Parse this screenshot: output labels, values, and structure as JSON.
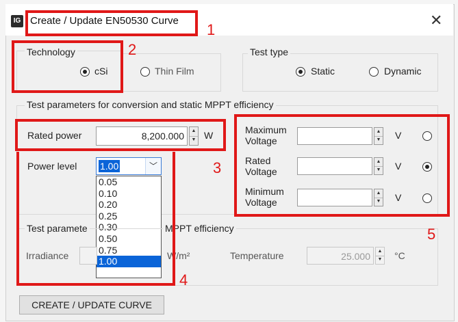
{
  "window": {
    "title": "Create / Update EN50530 Curve",
    "close_label": "✕",
    "icon_text": "IG"
  },
  "technology": {
    "legend": "Technology",
    "options": [
      {
        "label": "cSi",
        "selected": true
      },
      {
        "label": "Thin Film",
        "selected": false
      }
    ]
  },
  "test_type": {
    "legend": "Test type",
    "options": [
      {
        "label": "Static",
        "selected": true
      },
      {
        "label": "Dynamic",
        "selected": false
      }
    ]
  },
  "static_params": {
    "legend": "Test parameters for conversion and static MPPT efficiency",
    "rated_power": {
      "label": "Rated power",
      "value": "8,200.000",
      "unit": "W"
    },
    "power_level": {
      "label": "Power level",
      "value": "1.00",
      "options": [
        "0.05",
        "0.10",
        "0.20",
        "0.25",
        "0.30",
        "0.50",
        "0.75",
        "1.00"
      ]
    },
    "voltages": [
      {
        "label_line1": "Maximum",
        "label_line2": "Voltage",
        "value": "",
        "unit": "V",
        "selected": false
      },
      {
        "label_line1": "Rated",
        "label_line2": "Voltage",
        "value": "",
        "unit": "V",
        "selected": true
      },
      {
        "label_line1": "Minimum",
        "label_line2": "Voltage",
        "value": "",
        "unit": "V",
        "selected": false
      }
    ]
  },
  "dynamic_params": {
    "legend_left": "Test paramete",
    "legend_right": "MPPT efficiency",
    "irradiance": {
      "label": "Irradiance",
      "value": "",
      "unit": "W/m²"
    },
    "temperature": {
      "label": "Temperature",
      "value": "25.000",
      "unit": "°C"
    }
  },
  "annotations": [
    "1",
    "2",
    "3",
    "4",
    "5"
  ],
  "actions": {
    "create_update": "CREATE / UPDATE CURVE"
  },
  "colors": {
    "annotation_red": "#e01818",
    "selection_blue": "#0a64d8"
  }
}
